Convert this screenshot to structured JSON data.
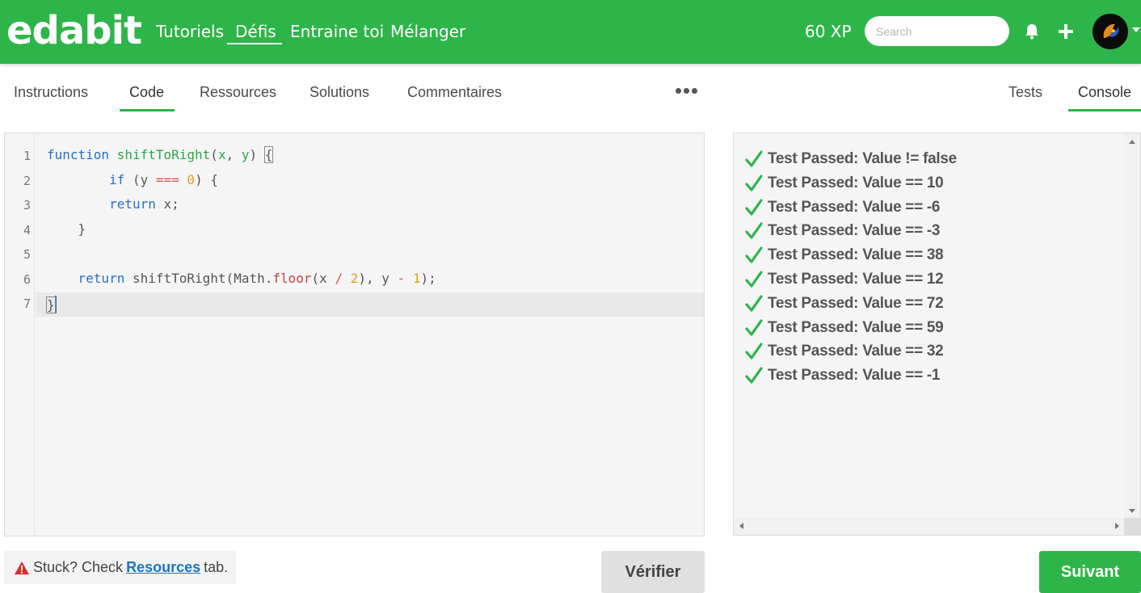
{
  "header": {
    "logo": "edabit",
    "nav": [
      "Tutoriels",
      "Défis",
      "Entraine toi",
      "Mélanger"
    ],
    "xp": "60 XP",
    "search_placeholder": "Search",
    "brand_color": "#2eb549",
    "icons": [
      "bell-icon",
      "plus-icon",
      "avatar",
      "chevron-down-icon"
    ]
  },
  "left_tabs": [
    "Instructions",
    "Code",
    "Ressources",
    "Solutions",
    "Commentaires"
  ],
  "left_active_tab": "Code",
  "right_tabs": [
    "Tests",
    "Console"
  ],
  "right_active_tab": "Console",
  "editor": {
    "line_numbers": [
      "1",
      "2",
      "3",
      "4",
      "5",
      "6",
      "7"
    ],
    "lines": [
      "function shiftToRight(x, y) {",
      "        if (y === 0) {",
      "        return x;",
      "    }",
      "",
      "    return shiftToRight(Math.floor(x / 2), y - 1);",
      "}"
    ],
    "tokens": {
      "l1": {
        "kw": "function",
        "fn": "shiftToRight",
        "open": "(",
        "p1": "x",
        "comma": ", ",
        "p2": "y",
        "close": ") ",
        "brace": "{"
      },
      "l2": {
        "kw": "if",
        "a": " (",
        "v": "y",
        "op": "===",
        "num": "0",
        "b": ") {"
      },
      "l3": {
        "kw": "return",
        "rest": " x;"
      },
      "l4": {
        "brace": "}"
      },
      "l6": {
        "kw": "return",
        "fn": " shiftToRight(",
        "obj": "Math.",
        "prop": "floor",
        "a": "(x ",
        "op1": "/",
        "n1": "2",
        "b": "), y ",
        "op2": "-",
        "n2": "1",
        "c": ");"
      },
      "l7": {
        "brace": "}"
      }
    }
  },
  "console": {
    "results": [
      "Test Passed: Value != false",
      "Test Passed: Value == 10",
      "Test Passed: Value == -6",
      "Test Passed: Value == -3",
      "Test Passed: Value == 38",
      "Test Passed: Value == 12",
      "Test Passed: Value == 72",
      "Test Passed: Value == 59",
      "Test Passed: Value == 32",
      "Test Passed: Value == -1"
    ],
    "pass_color": "#2eb549"
  },
  "footer": {
    "stuck_prefix": "Stuck? Check",
    "stuck_link": "Resources",
    "stuck_suffix": "tab.",
    "verify_label": "Vérifier",
    "next_label": "Suivant"
  }
}
